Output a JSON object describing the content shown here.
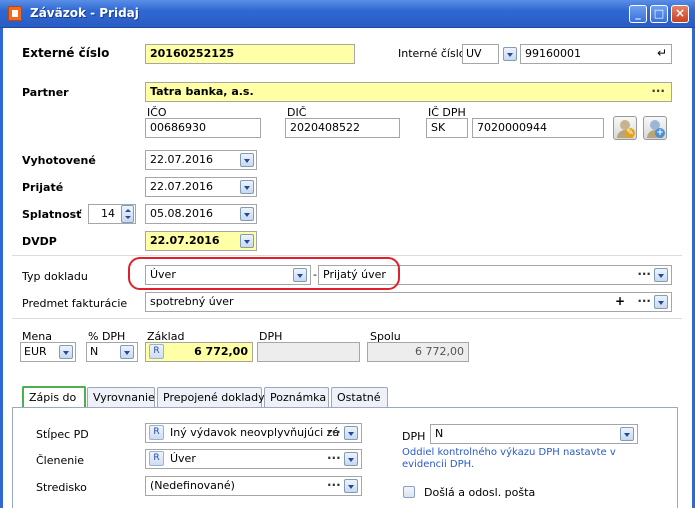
{
  "window": {
    "title": "Záväzok - Pridaj",
    "minimize": "_",
    "maximize": "□",
    "close": "×"
  },
  "icons": {
    "app": "document-icon",
    "dropdown": "chevron-down-icon",
    "more": "ellipsis-icon",
    "add": "plus-icon",
    "spin": "spin-arrows-icon",
    "reset": "arrow-return-icon",
    "partner_edit": "person-edit-icon",
    "partner_add": "person-add-icon"
  },
  "colors": {
    "title_bar": "#2f68d2",
    "required_field": "#ffffa6",
    "active_tab_border": "#4caf50",
    "highlight": "#e0202a",
    "link_note": "#2a5ac8"
  },
  "external_number": {
    "label": "Externé číslo",
    "value": "20160252125"
  },
  "internal_number": {
    "label": "Interné číslo",
    "series": "UV",
    "value": "99160001",
    "reset_glyph": "↵"
  },
  "partner": {
    "label": "Partner",
    "name": "Tatra banka, a.s.",
    "more": "···",
    "ico_label": "IČO",
    "ico": "00686930",
    "dic_label": "DIČ",
    "dic": "2020408522",
    "icdph_label": "IČ DPH",
    "icdph_prefix": "SK",
    "icdph": "7020000944"
  },
  "dates": {
    "issued_label": "Vyhotovené",
    "issued": "22.07.2016",
    "received_label": "Prijaté",
    "received": "22.07.2016",
    "due_label": "Splatnosť",
    "due_days": "14",
    "due": "05.08.2016",
    "dvdp_label": "DVDP",
    "dvdp": "22.07.2016"
  },
  "doc_type": {
    "label": "Typ dokladu",
    "value": "Úver",
    "dash": "-",
    "description": "Prijatý úver",
    "more": "···"
  },
  "subject": {
    "label": "Predmet fakturácie",
    "value": "spotrebný úver",
    "add": "+",
    "more": "···"
  },
  "amounts": {
    "currency_label": "Mena",
    "currency": "EUR",
    "vat_rate_label": "% DPH",
    "vat_rate": "N",
    "base_label": "Základ",
    "base_badge": "R",
    "base": "6 772,00",
    "vat_label": "DPH",
    "vat": "",
    "total_label": "Spolu",
    "total": "6 772,00"
  },
  "tabs": [
    {
      "label": "Zápis do",
      "active": true
    },
    {
      "label": "Vyrovnanie",
      "active": false
    },
    {
      "label": "Prepojené doklady",
      "active": false
    },
    {
      "label": "Poznámka",
      "active": false
    },
    {
      "label": "Ostatné",
      "active": false
    }
  ],
  "zapis": {
    "column_label": "Stĺpec PD",
    "column_badge": "R",
    "column_value": "Iný výdavok neovplyvňujúci zá",
    "division_label": "Členenie",
    "division_badge": "R",
    "division_value": "Úver",
    "center_label": "Stredisko",
    "center_value": "(Nedefinované)",
    "more": "···",
    "vat_label": "DPH",
    "vat_value": "N",
    "vat_note": "Oddiel kontrolného výkazu DPH nastavte v evidencii DPH.",
    "mail_label": "Došlá a odosl. pošta"
  }
}
